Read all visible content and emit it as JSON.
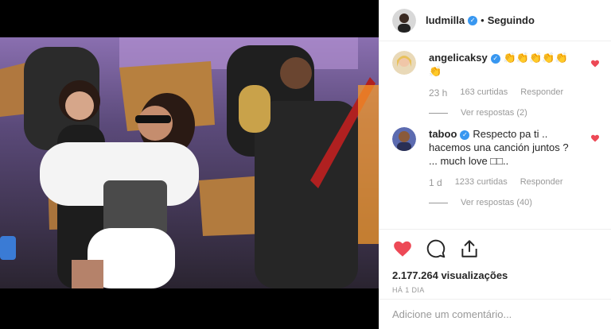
{
  "header": {
    "username": "ludmilla",
    "separator": "•",
    "follow_status": "Seguindo"
  },
  "comments": [
    {
      "username": "angelicaksy",
      "text": "👏👏👏👏👏👏",
      "time": "23 h",
      "likes": "163 curtidas",
      "reply_label": "Responder",
      "view_replies": "Ver respostas (2)",
      "liked": true
    },
    {
      "username": "taboo",
      "text": "Respecto pa ti .. hacemos una canción juntos ? ... much love □□..",
      "time": "1 d",
      "likes": "1233 curtidas",
      "reply_label": "Responder",
      "view_replies": "Ver respostas (40)",
      "liked": true
    }
  ],
  "stats": {
    "views": "2.177.264 visualizações",
    "posted": "HÁ 1 DIA"
  },
  "add_comment": {
    "placeholder": "Adicione um comentário..."
  },
  "colors": {
    "accent_blue": "#3897f0",
    "like_red": "#ed4956",
    "muted": "#999999"
  },
  "icons": {
    "like": "heart-icon",
    "comment": "comment-bubble-icon",
    "share": "share-upload-icon",
    "verified": "verified-badge-icon"
  }
}
